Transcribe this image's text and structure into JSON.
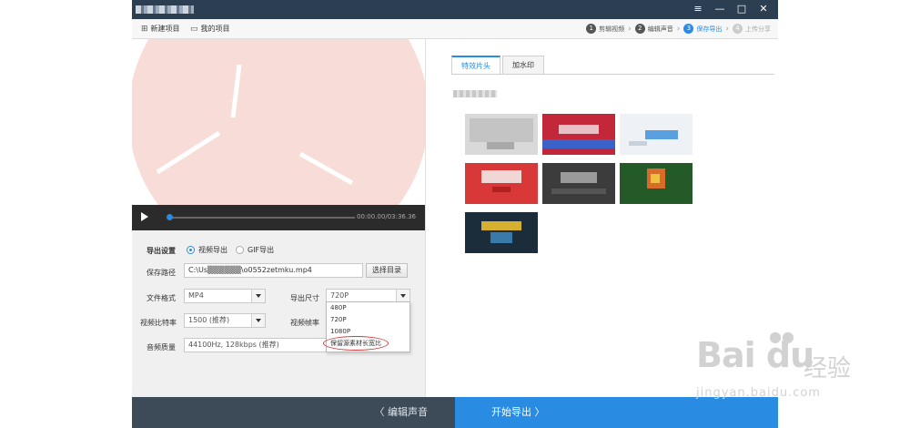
{
  "window": {
    "title": "",
    "min_label": "—",
    "max_label": "□",
    "close_label": "✕",
    "settings_label": "≡"
  },
  "menu": {
    "new_project": "新建项目",
    "my_projects": "我的项目"
  },
  "steps": [
    {
      "num": "1",
      "label": "剪辑视频",
      "state": "done"
    },
    {
      "num": "2",
      "label": "编辑声音",
      "state": "done"
    },
    {
      "num": "3",
      "label": "保存导出",
      "state": "active"
    },
    {
      "num": "4",
      "label": "上传分享",
      "state": "disabled"
    }
  ],
  "player": {
    "time": "00:00.00/03:36.36"
  },
  "export": {
    "settings_label": "导出设置",
    "mode_video": "视频导出",
    "mode_gif": "GIF导出",
    "path_label": "保存路径",
    "path_value": "C:\\Us▒▒▒▒▒▒\\o0552zetmku.mp4",
    "browse_button": "选择目录",
    "format_label": "文件格式",
    "format_value": "MP4",
    "size_label": "导出尺寸",
    "size_value": "720P",
    "bitrate_label": "视频比特率",
    "bitrate_value": "1500 (推荐)",
    "framerate_label": "视频帧率",
    "quality_label": "音频质量",
    "quality_value": "44100Hz, 128kbps (推荐)",
    "size_options": [
      "480P",
      "720P",
      "1080P",
      "保留源素材长宽比"
    ]
  },
  "tabs": [
    {
      "label": "特效片头",
      "active": true
    },
    {
      "label": "加水印",
      "active": false
    }
  ],
  "thumbnails": [
    {
      "name": "thumb-1",
      "color": "#cfcfcf"
    },
    {
      "name": "thumb-2",
      "color": "#c92a3a"
    },
    {
      "name": "thumb-3",
      "color": "#e8eef4"
    },
    {
      "name": "thumb-4",
      "color": "#d93a3a"
    },
    {
      "name": "thumb-5",
      "color": "#3a3a3a"
    },
    {
      "name": "thumb-6",
      "color": "#245a2a"
    },
    {
      "name": "thumb-7",
      "color": "#1c2d3c"
    }
  ],
  "bottom": {
    "back_label": "〈 编辑声音",
    "next_label": "开始导出 〉"
  },
  "watermark": {
    "main": "Bai du",
    "cn": "经验",
    "sub": "jingyan.baidu.com"
  },
  "colors": {
    "accent": "#2a8be3",
    "titlebar": "#2c3e52",
    "back_button": "#3d4a57",
    "highlight_ring": "#d63a3a"
  }
}
